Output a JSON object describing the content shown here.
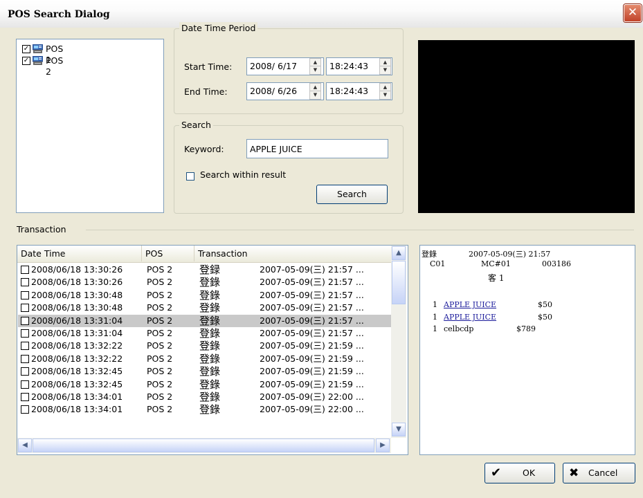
{
  "window": {
    "title": "POS Search Dialog",
    "close_glyph": "✕"
  },
  "pos_tree": {
    "items": [
      {
        "label": "POS 1",
        "checked": true
      },
      {
        "label": "POS 2",
        "checked": true
      }
    ]
  },
  "date_time_period": {
    "legend": "Date Time Period",
    "start_label": "Start Time:",
    "start_date": "2008/ 6/17",
    "start_time": "18:24:43",
    "end_label": "End Time:",
    "end_date": "2008/ 6/26",
    "end_time": "18:24:43"
  },
  "search": {
    "legend": "Search",
    "keyword_label": "Keyword:",
    "keyword_value": "APPLE JUICE",
    "within_label": "Search within result",
    "within_checked": false,
    "button_label": "Search"
  },
  "transaction": {
    "legend": "Transaction",
    "columns": [
      "Date Time",
      "POS",
      "Transaction"
    ],
    "rows": [
      {
        "datetime": "2008/06/18 13:30:26",
        "pos": "POS 2",
        "type": "登録",
        "detail": "2007-05-09(三)   21:57 ..."
      },
      {
        "datetime": "2008/06/18 13:30:26",
        "pos": "POS 2",
        "type": "登錄",
        "detail": "2007-05-09(三)   21:57 ..."
      },
      {
        "datetime": "2008/06/18 13:30:48",
        "pos": "POS 2",
        "type": "登錄",
        "detail": "2007-05-09(三)   21:57 ..."
      },
      {
        "datetime": "2008/06/18 13:30:48",
        "pos": "POS 2",
        "type": "登錄",
        "detail": "2007-05-09(三)   21:57 ..."
      },
      {
        "datetime": "2008/06/18 13:31:04",
        "pos": "POS 2",
        "type": "登錄",
        "detail": "2007-05-09(三)   21:57 ...",
        "selected": true
      },
      {
        "datetime": "2008/06/18 13:31:04",
        "pos": "POS 2",
        "type": "登錄",
        "detail": "2007-05-09(三)   21:57 ..."
      },
      {
        "datetime": "2008/06/18 13:32:22",
        "pos": "POS 2",
        "type": "登錄",
        "detail": "2007-05-09(三)   21:59 ..."
      },
      {
        "datetime": "2008/06/18 13:32:22",
        "pos": "POS 2",
        "type": "登錄",
        "detail": "2007-05-09(三)   21:59 ..."
      },
      {
        "datetime": "2008/06/18 13:32:45",
        "pos": "POS 2",
        "type": "登錄",
        "detail": "2007-05-09(三)   21:59 ..."
      },
      {
        "datetime": "2008/06/18 13:32:45",
        "pos": "POS 2",
        "type": "登錄",
        "detail": "2007-05-09(三)   21:59 ..."
      },
      {
        "datetime": "2008/06/18 13:34:01",
        "pos": "POS 2",
        "type": "登錄",
        "detail": "2007-05-09(三)   22:00 ..."
      },
      {
        "datetime": "2008/06/18 13:34:01",
        "pos": "POS 2",
        "type": "登錄",
        "detail": "2007-05-09(三)   22:00 ..."
      }
    ]
  },
  "receipt": {
    "header_label": "登錄",
    "header_datetime": "2007-05-09(三)  21:57",
    "store": "C01",
    "machine": "MC#01",
    "number": "003186",
    "customer": "客 1",
    "items": [
      {
        "qty": "1",
        "name": "APPLE JUICE",
        "price": "$50",
        "highlight": true
      },
      {
        "qty": "1",
        "name": "APPLE JUICE",
        "price": "$50",
        "highlight": true
      },
      {
        "qty": "1",
        "name": "celbcdp",
        "price": "$789",
        "highlight": false
      }
    ]
  },
  "buttons": {
    "ok": "OK",
    "cancel": "Cancel"
  },
  "icons": {
    "spin_up": "▲",
    "spin_down": "▼",
    "scroll_up": "▲",
    "scroll_down": "▼",
    "scroll_left": "◀",
    "scroll_right": "▶",
    "ok": "✔",
    "cancel": "✖"
  },
  "colors": {
    "title_close": "#c1432a",
    "video_background": "#000000",
    "selection": "#c9c9c9",
    "receipt_link": "#1b1b9b"
  }
}
